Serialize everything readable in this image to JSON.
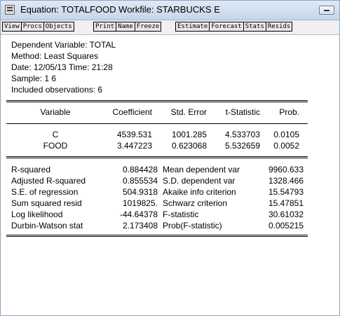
{
  "window": {
    "title": "Equation: TOTALFOOD    Workfile: STARBUCKS E"
  },
  "toolbar": {
    "group1": [
      "View",
      "Procs",
      "Objects"
    ],
    "group2": [
      "Print",
      "Name",
      "Freeze"
    ],
    "group3": [
      "Estimate",
      "Forecast",
      "Stats",
      "Resids"
    ]
  },
  "header": {
    "dependent_variable": "Dependent Variable: TOTAL",
    "method": "Method: Least Squares",
    "date": "Date: 12/05/13   Time: 21:28",
    "sample": "Sample: 1 6",
    "observations": "Included observations: 6"
  },
  "table": {
    "columns": [
      "Variable",
      "Coefficient",
      "Std. Error",
      "t-Statistic",
      "Prob."
    ],
    "rows": [
      {
        "variable": "C",
        "coefficient": "4539.531",
        "std_error": "1001.285",
        "t_stat": "4.533703",
        "prob": "0.0105"
      },
      {
        "variable": "FOOD",
        "coefficient": "3.447223",
        "std_error": "0.623068",
        "t_stat": "5.532659",
        "prob": "0.0052"
      }
    ]
  },
  "stats": {
    "left": [
      {
        "label": "R-squared",
        "value": "0.884428"
      },
      {
        "label": "Adjusted R-squared",
        "value": "0.855534"
      },
      {
        "label": "S.E. of regression",
        "value": "504.9318"
      },
      {
        "label": "Sum squared resid",
        "value": "1019825."
      },
      {
        "label": "Log likelihood",
        "value": "-44.64378"
      },
      {
        "label": "Durbin-Watson stat",
        "value": "2.173408"
      }
    ],
    "right": [
      {
        "label": "Mean dependent var",
        "value": "9960.633"
      },
      {
        "label": "S.D. dependent var",
        "value": "1328.466"
      },
      {
        "label": "Akaike info criterion",
        "value": "15.54793"
      },
      {
        "label": "Schwarz criterion",
        "value": "15.47851"
      },
      {
        "label": "F-statistic",
        "value": "30.61032"
      },
      {
        "label": "Prob(F-statistic)",
        "value": "0.005215"
      }
    ]
  }
}
